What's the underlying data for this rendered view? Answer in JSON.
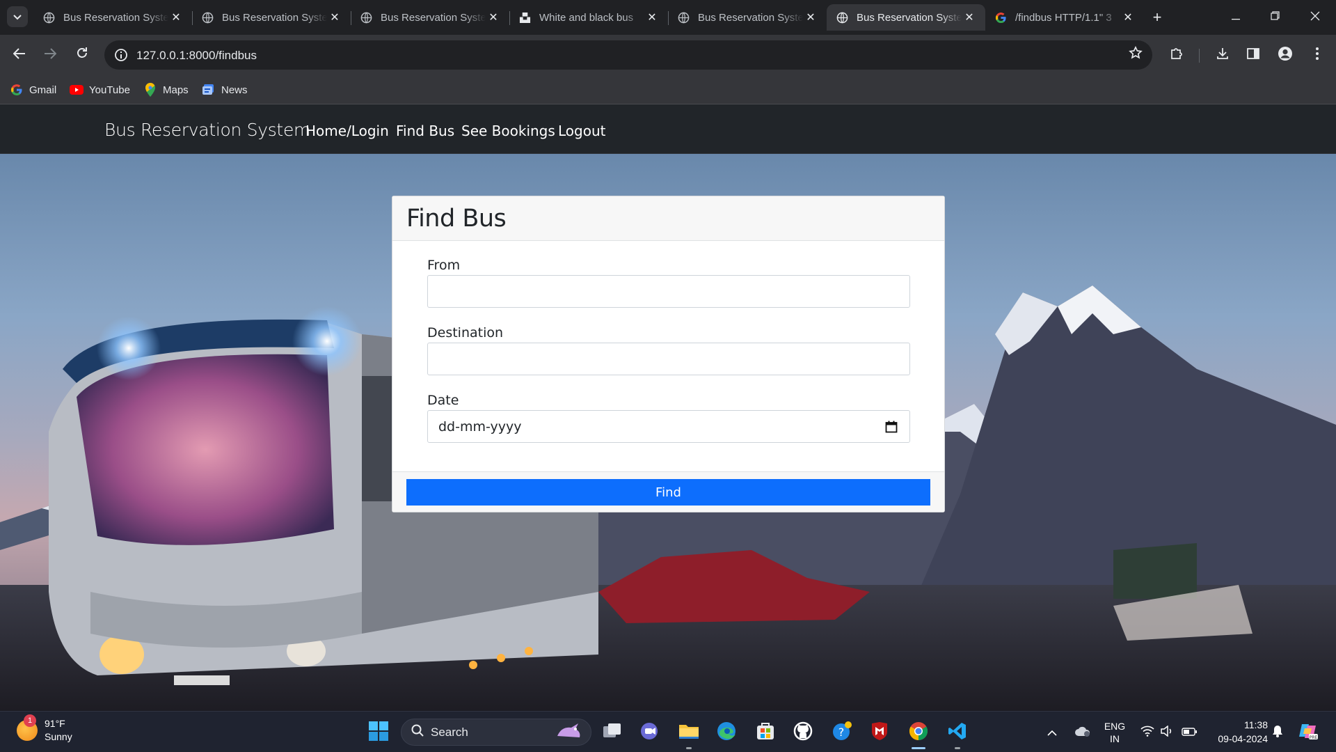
{
  "browser": {
    "tabs": [
      {
        "title": "Bus Reservation System",
        "favicon": "globe-icon",
        "active": false
      },
      {
        "title": "Bus Reservation System",
        "favicon": "globe-icon",
        "active": false
      },
      {
        "title": "Bus Reservation System",
        "favicon": "globe-icon",
        "active": false
      },
      {
        "title": "White and black bus",
        "favicon": "unsplash-icon",
        "active": false
      },
      {
        "title": "Bus Reservation System",
        "favicon": "globe-icon",
        "active": false
      },
      {
        "title": "Bus Reservation System",
        "favicon": "globe-icon",
        "active": true
      },
      {
        "title": "/findbus HTTP/1.1\" 3",
        "favicon": "google-icon",
        "active": false
      }
    ],
    "url": "127.0.0.1:8000/findbus",
    "bookmarks": [
      {
        "label": "Gmail",
        "icon": "google-icon"
      },
      {
        "label": "YouTube",
        "icon": "youtube-icon"
      },
      {
        "label": "Maps",
        "icon": "maps-icon"
      },
      {
        "label": "News",
        "icon": "news-icon"
      }
    ]
  },
  "page": {
    "brand": "Bus Reservation System",
    "nav": [
      "Home/Login",
      "Find Bus",
      "See Bookings",
      "Logout"
    ],
    "form": {
      "title": "Find Bus",
      "from_label": "From",
      "from_value": "",
      "destination_label": "Destination",
      "destination_value": "",
      "date_label": "Date",
      "date_placeholder": "dd-mm-yyyy",
      "submit_label": "Find"
    },
    "colors": {
      "navbar": "#212529",
      "primary_button": "#0d6efd"
    }
  },
  "taskbar": {
    "weather": {
      "temp": "91°F",
      "condition": "Sunny",
      "badge": "1"
    },
    "search_label": "Search",
    "language": {
      "lang": "ENG",
      "region": "IN"
    },
    "time": "11:38",
    "date": "09-04-2024"
  }
}
